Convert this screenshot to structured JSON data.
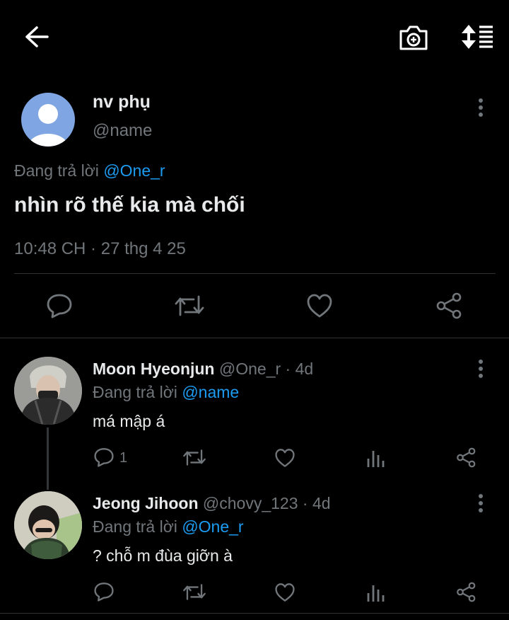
{
  "topbar": {
    "back_icon": "arrow-left-icon",
    "camera_icon": "camera-plus-icon",
    "sort_icon": "sort-list-icon"
  },
  "main_tweet": {
    "author_name": "nv phụ",
    "author_handle": "@name",
    "replying_prefix": "Đang trả lời",
    "replying_to": "@One_r",
    "text": "nhìn rõ thế kia mà chối",
    "timestamp": "10:48 CH · 27 thg 4 25"
  },
  "replies": [
    {
      "name": "Moon Hyeonjun",
      "handle": "@One_r",
      "time": "· 4d",
      "replying_prefix": "Đang trả lời",
      "replying_to": "@name",
      "text": "má mập á",
      "reply_count": "1"
    },
    {
      "name": "Jeong Jihoon",
      "handle": "@chovy_123",
      "time": "· 4d",
      "replying_prefix": "Đang trả lời",
      "replying_to": "@One_r",
      "text": "? chỗ m đùa giỡn à",
      "reply_count": ""
    }
  ],
  "colors": {
    "background": "#000000",
    "text": "#e7e9ea",
    "muted": "#71767b",
    "accent": "#1d9bf0",
    "divider": "#2f3336"
  }
}
